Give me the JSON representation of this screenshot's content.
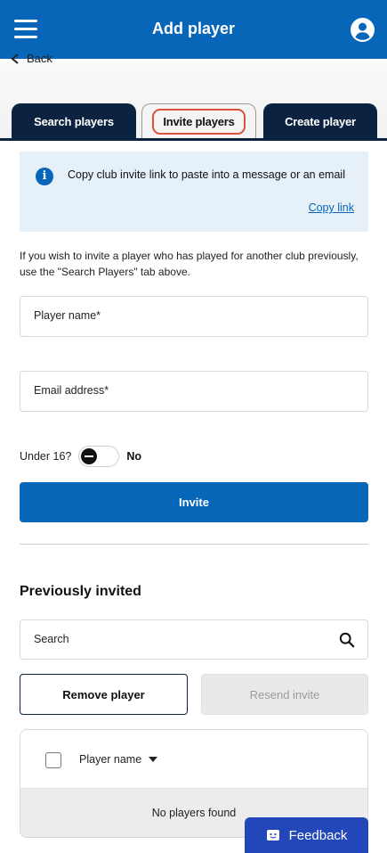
{
  "header": {
    "title": "Add player"
  },
  "nav": {
    "back_label": "Back"
  },
  "tabs": [
    {
      "label": "Search players"
    },
    {
      "label": "Invite players"
    },
    {
      "label": "Create player"
    }
  ],
  "info": {
    "text": "Copy club invite link to paste into a message or an email",
    "link": "Copy link"
  },
  "help_text": "If you wish to invite a player who has played for another club previously, use the \"Search Players\" tab above.",
  "form": {
    "player_name_label": "Player name*",
    "email_label": "Email address*",
    "under16_label": "Under 16?",
    "under16_value": "No",
    "invite_label": "Invite"
  },
  "previously_invited": {
    "title": "Previously invited",
    "search_label": "Search",
    "remove_label": "Remove player",
    "resend_label": "Resend invite",
    "columns": [
      "Player name"
    ],
    "empty_text": "No players found"
  },
  "feedback": {
    "label": "Feedback"
  },
  "colors": {
    "primary": "#0766b8",
    "tab_dark": "#0b2340",
    "tab_highlight": "#d9533f",
    "feedback": "#2346b8",
    "info_bg": "#e6f0f8"
  }
}
